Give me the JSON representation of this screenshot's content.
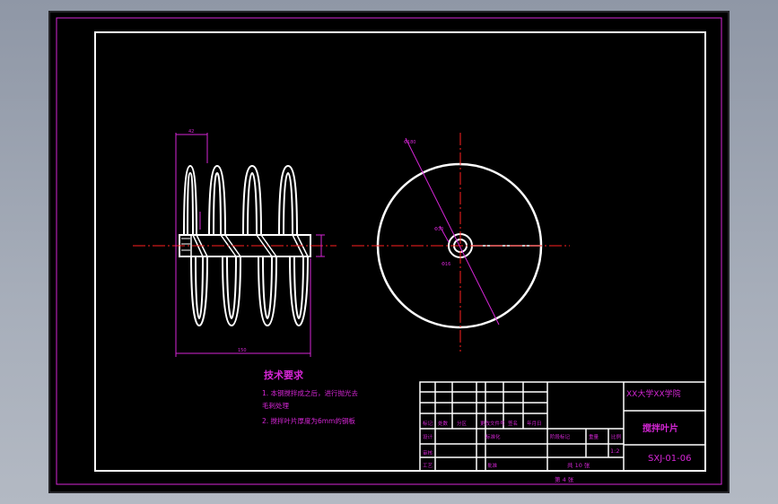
{
  "colors": {
    "frame": "#ffffff",
    "annotation": "#d626d6",
    "centerline": "#ff2020",
    "sheet": "#000000",
    "app_background": "#9aa2b0"
  },
  "drawing": {
    "tech_requirements": {
      "title": "技术要求",
      "lines": [
        "1. 本钢搅拌成之后，进行抛光去",
        "毛刺处理",
        "2. 搅拌叶片厚度为6mm的钢板"
      ]
    },
    "title_block": {
      "school": "XX大学XX学院",
      "part_name": "搅拌叶片",
      "drawing_number": "SXJ-01-06",
      "sheet_total": "共 10 张",
      "sheet_index": "第 4 张",
      "header_labels": [
        "标记",
        "处数",
        "分区",
        "更改文件号",
        "签名",
        "年月日"
      ],
      "left_labels": [
        "设计",
        "审核",
        "工艺"
      ],
      "left_mid_label": "标准化",
      "approve_label": "批准",
      "stage_labels": [
        "阶段标记",
        "重量",
        "比例"
      ],
      "scale_value": "1:2"
    }
  }
}
